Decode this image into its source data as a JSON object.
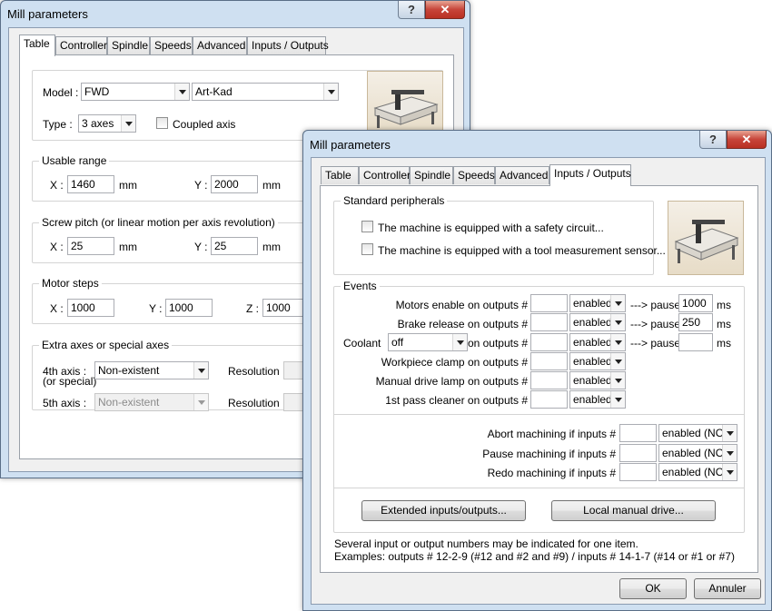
{
  "back_window": {
    "title": "Mill parameters",
    "help_glyph": "?",
    "close_glyph": "✕",
    "tabs": [
      "Table",
      "Controller",
      "Spindle",
      "Speeds",
      "Advanced",
      "Inputs / Outputs"
    ],
    "model_label": "Model :",
    "model_value": "FWD",
    "model_value2": "Art-Kad",
    "type_label": "Type :",
    "type_value": "3 axes",
    "coupled_label": "Coupled axis",
    "usable_range_label": "Usable range",
    "x_label": "X :",
    "y_label": "Y :",
    "z_label": "Z :",
    "range_x": "1460",
    "range_y": "2000",
    "mm": "mm",
    "screw_pitch_label": "Screw pitch  (or linear motion per axis revolution)",
    "pitch_x": "25",
    "pitch_y": "25",
    "motor_steps_label": "Motor steps",
    "steps_x": "1000",
    "steps_y": "1000",
    "steps_z": "1000",
    "extra_axes_label": "Extra axes or special axes",
    "axis4_label_1": "4th axis :",
    "axis4_label_2": "(or special)",
    "axis4_value": "Non-existent",
    "axis5_label": "5th axis :",
    "axis5_value": "Non-existent",
    "resolution_label": "Resolution :"
  },
  "front_window": {
    "title": "Mill parameters",
    "help_glyph": "?",
    "close_glyph": "✕",
    "tabs": [
      "Table",
      "Controller",
      "Spindle",
      "Speeds",
      "Advanced",
      "Inputs / Outputs"
    ],
    "standard_peripherals_label": "Standard peripherals",
    "safety_circuit_label": "The machine is equipped with a safety circuit...",
    "tool_sensor_label": "The machine is equipped with a tool measurement sensor...",
    "events_label": "Events",
    "outputs": [
      {
        "label": "Motors enable on outputs #",
        "output": "",
        "state": "enabled",
        "pause_label": "---> pause",
        "pause": "1000",
        "ms": "ms"
      },
      {
        "label": "Brake release on outputs #",
        "output": "",
        "state": "enabled",
        "pause_label": "---> pause",
        "pause": "250",
        "ms": "ms"
      },
      {
        "label": "on outputs #",
        "output": "",
        "state": "enabled",
        "pause_label": "---> pause",
        "pause": "",
        "ms": "ms"
      },
      {
        "label": "Workpiece clamp on outputs #",
        "output": "",
        "state": "enabled"
      },
      {
        "label": "Manual drive lamp on outputs #",
        "output": "",
        "state": "enabled"
      },
      {
        "label": "1st pass cleaner on outputs #",
        "output": "",
        "state": "enabled"
      }
    ],
    "coolant_label": "Coolant",
    "coolant_value": "off",
    "inputs": [
      {
        "label": "Abort machining if inputs #",
        "input": "",
        "state": "enabled (NO)"
      },
      {
        "label": "Pause machining if inputs #",
        "input": "",
        "state": "enabled (NO)"
      },
      {
        "label": "Redo machining if inputs #",
        "input": "",
        "state": "enabled (NO)"
      }
    ],
    "extended_io_button": "Extended inputs/outputs...",
    "local_drive_button": "Local manual drive...",
    "note_line1": "Several input or output numbers may be indicated for one item.",
    "note_line2": "Examples: outputs # 12-2-9  (#12 and #2 and #9)  /  inputs # 14-1-7  (#14 or #1 or #7)",
    "ok_button": "OK",
    "cancel_button": "Annuler"
  }
}
